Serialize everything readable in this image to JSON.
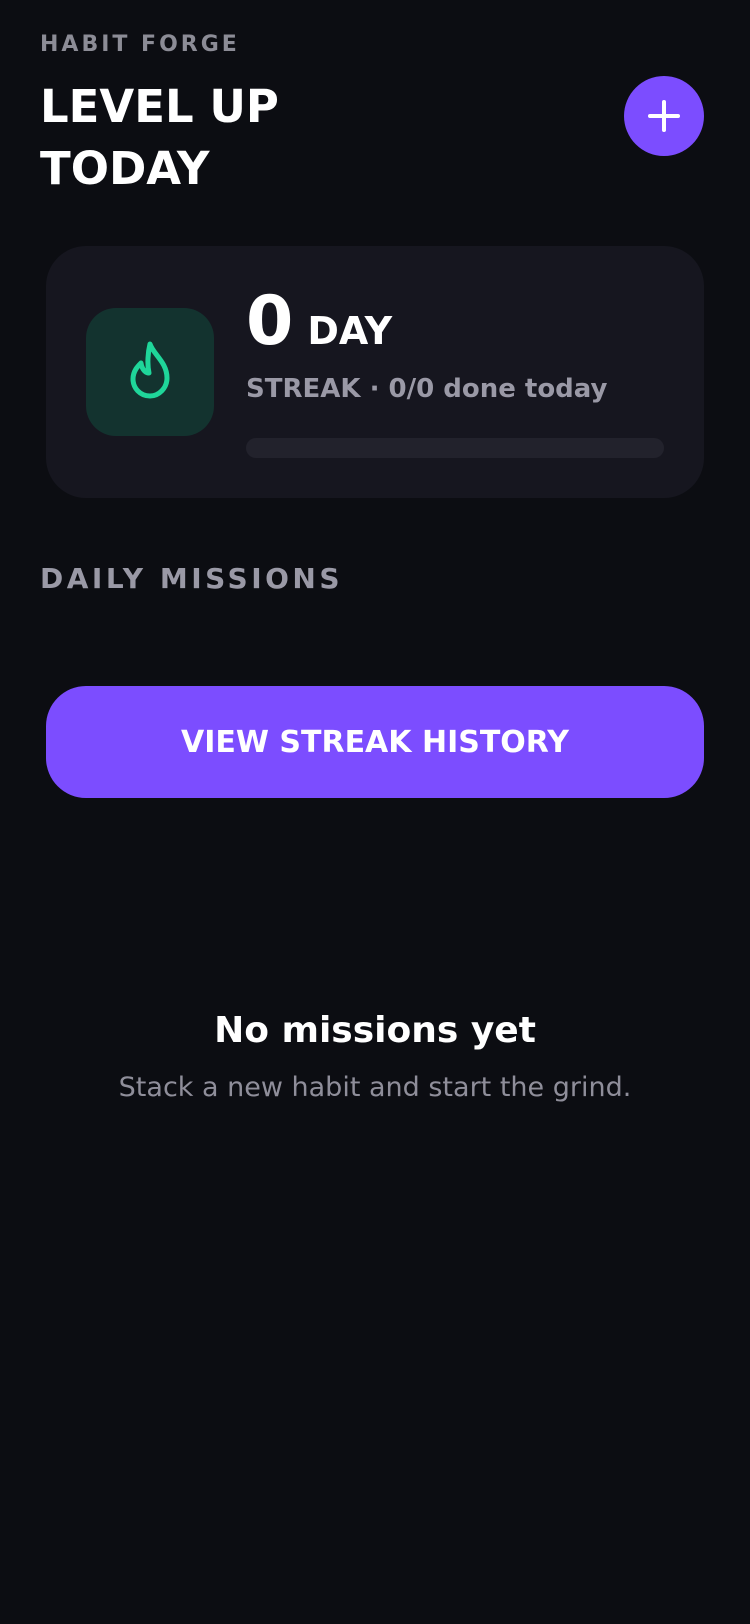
{
  "header": {
    "app_label": "HABIT FORGE",
    "title": "LEVEL UP TODAY",
    "add_icon": "plus-icon"
  },
  "streak_card": {
    "icon": "flame-icon",
    "count": "0",
    "unit": "DAY",
    "subtitle": "STREAK · 0/0 done today",
    "progress_fraction": 0,
    "accent_color": "#1fd69a"
  },
  "missions": {
    "section_title": "DAILY MISSIONS"
  },
  "history_button": {
    "label": "VIEW STREAK HISTORY"
  },
  "empty_state": {
    "title": "No missions yet",
    "subtitle": "Stack a new habit and start the grind."
  },
  "colors": {
    "background": "#0c0d12",
    "card": "#16161f",
    "primary": "#7c4dff",
    "accent": "#1fd69a",
    "muted_text": "#9a99a6"
  }
}
